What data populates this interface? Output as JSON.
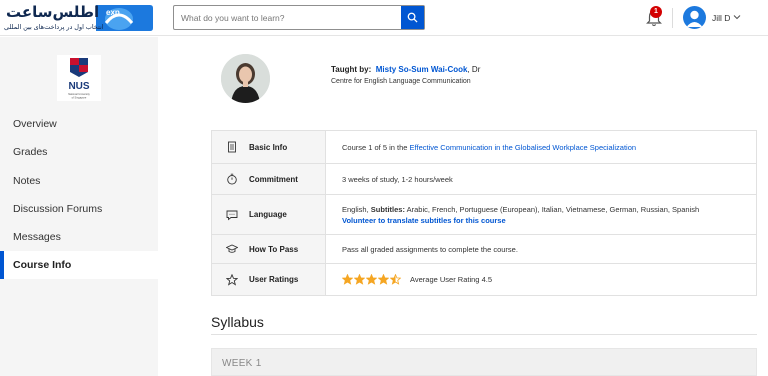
{
  "header": {
    "logo_text": "اطلس‌ساعت",
    "logo_subtitle": "انتخاب اول در پرداخت‌های بین المللی",
    "logo_badge": "exp",
    "search_placeholder": "What do you want to learn?",
    "notification_count": "1",
    "user_name": "Jill D",
    "accent_color": "#0056d2"
  },
  "sidebar": {
    "institution_logo_text": "NUS",
    "institution_logo_sub": "National University of Singapore",
    "items": [
      {
        "label": "Overview"
      },
      {
        "label": "Grades"
      },
      {
        "label": "Notes"
      },
      {
        "label": "Discussion Forums"
      },
      {
        "label": "Messages"
      },
      {
        "label": "Course Info"
      }
    ],
    "active_item": "Course Info"
  },
  "instructor": {
    "taught_by_label": "Taught by:",
    "name": "Misty So-Sum Wai-Cook",
    "title_suffix": ", Dr",
    "department": "Centre for English Language Communication"
  },
  "info": {
    "basic": {
      "icon": "document-icon",
      "label": "Basic Info",
      "prefix": "Course 1 of 5 in the ",
      "link": "Effective Communication in the Globalised Workplace Specialization"
    },
    "commitment": {
      "icon": "stopwatch-icon",
      "label": "Commitment",
      "value": "3 weeks of study, 1-2 hours/week"
    },
    "language": {
      "icon": "chat-bubble-icon",
      "label": "Language",
      "lang": "English,",
      "subtitles_label": "Subtitles:",
      "subtitles": "Arabic, French, Portuguese (European), Italian, Vietnamese, German, Russian, Spanish",
      "volunteer": "Volunteer to translate subtitles for this course"
    },
    "pass": {
      "icon": "graduation-cap-icon",
      "label": "How To Pass",
      "value": "Pass all graded assignments to complete the course."
    },
    "ratings": {
      "icon": "star-outline-icon",
      "label": "User Ratings",
      "rating": 4.5,
      "text": "Average User Rating 4.5",
      "star_color": "#f5a623"
    }
  },
  "syllabus": {
    "title": "Syllabus",
    "weeks": [
      {
        "label": "WEEK 1"
      }
    ]
  }
}
